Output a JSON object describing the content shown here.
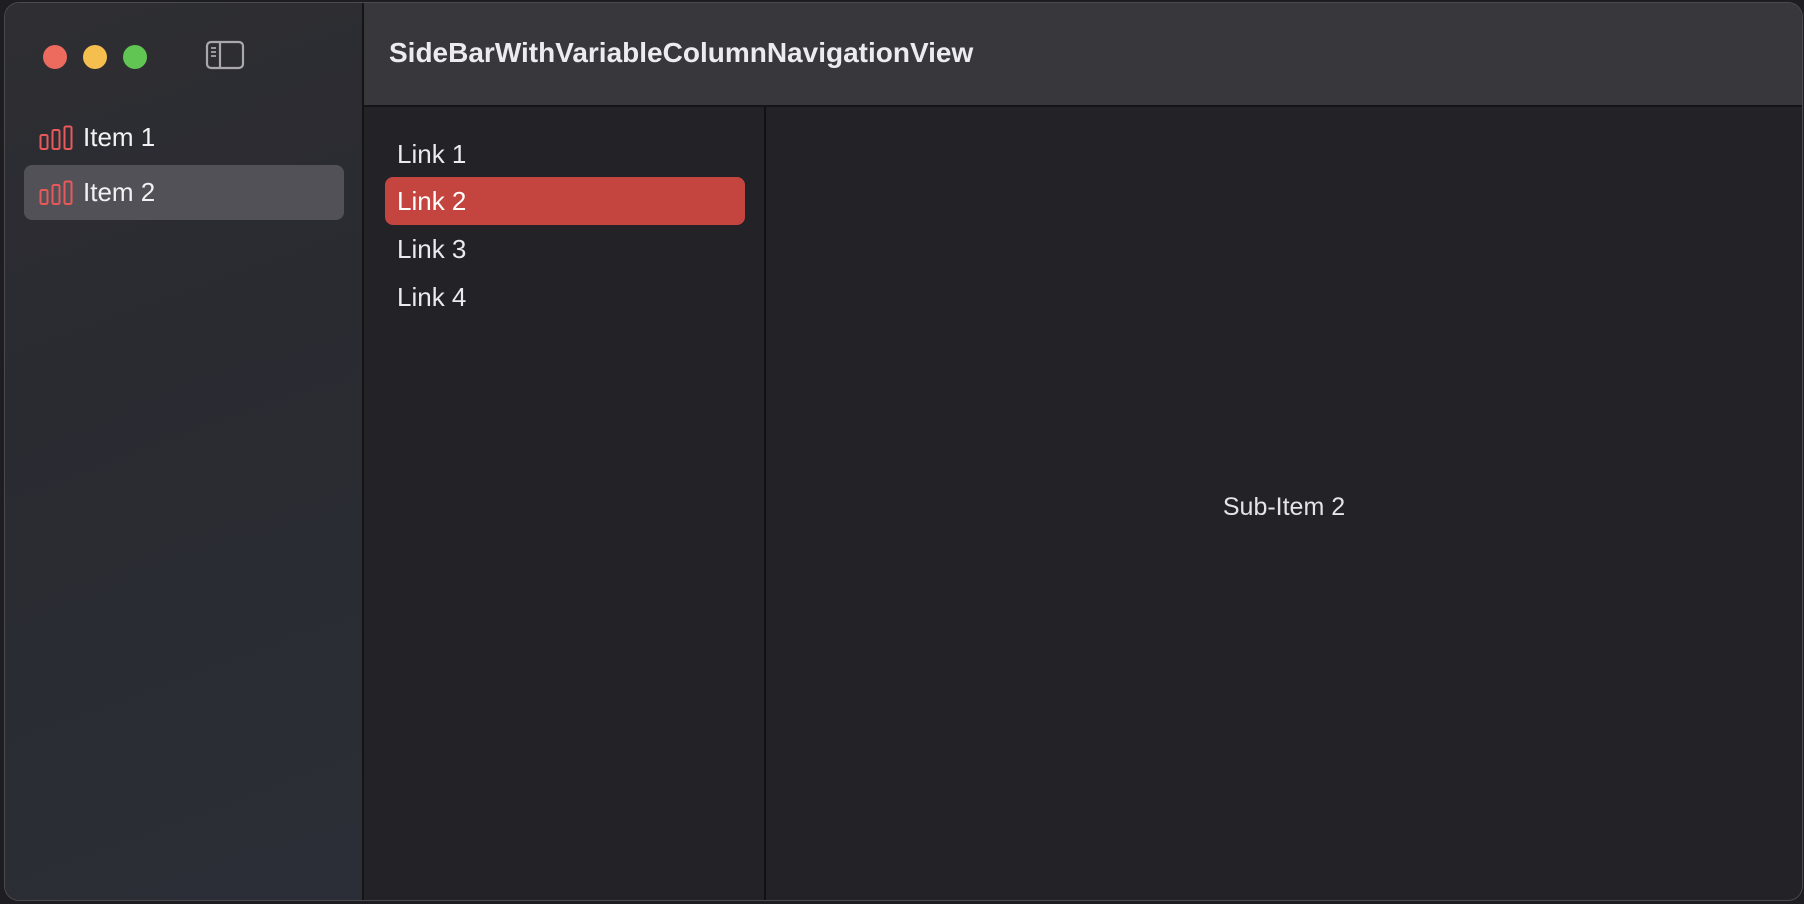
{
  "window": {
    "title": "SideBarWithVariableColumnNavigationView"
  },
  "colors": {
    "accent": "#c44440",
    "icon_accent": "#e8595a",
    "traffic_close": "#ec6a5e",
    "traffic_minimize": "#f4bf4f",
    "traffic_maximize": "#61c554"
  },
  "sidebar": {
    "toggle_icon": "sidebar-left-icon",
    "items": [
      {
        "label": "Item 1",
        "icon": "chart-bar-icon",
        "selected": false
      },
      {
        "label": "Item 2",
        "icon": "chart-bar-icon",
        "selected": true
      }
    ]
  },
  "content": {
    "links": [
      {
        "label": "Link 1",
        "selected": false
      },
      {
        "label": "Link 2",
        "selected": true
      },
      {
        "label": "Link 3",
        "selected": false
      },
      {
        "label": "Link 4",
        "selected": false
      }
    ]
  },
  "detail": {
    "text": "Sub-Item 2"
  }
}
